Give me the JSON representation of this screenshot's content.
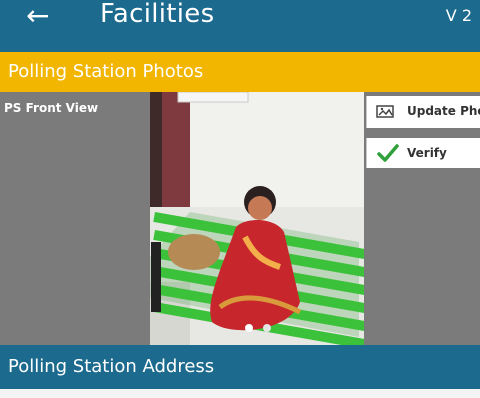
{
  "app_bar": {
    "back_icon": "arrow-left-icon",
    "title": "Facilities",
    "version": "V 2"
  },
  "photos_section": {
    "header": "Polling Station Photos",
    "view_label": "PS Front View",
    "update_photo_label": "Update Photo",
    "update_photo_icon": "image-upload-icon",
    "verify_label": "Verify",
    "verify_icon": "check-icon",
    "carousel": {
      "total_slides": 2,
      "active_index": 0
    }
  },
  "address_section": {
    "header": "Polling Station Address"
  },
  "colors": {
    "primary": "#1c6a8e",
    "accent": "#f2b500",
    "panel_gray": "#7b7b7b",
    "verify_green": "#2fa03a"
  }
}
